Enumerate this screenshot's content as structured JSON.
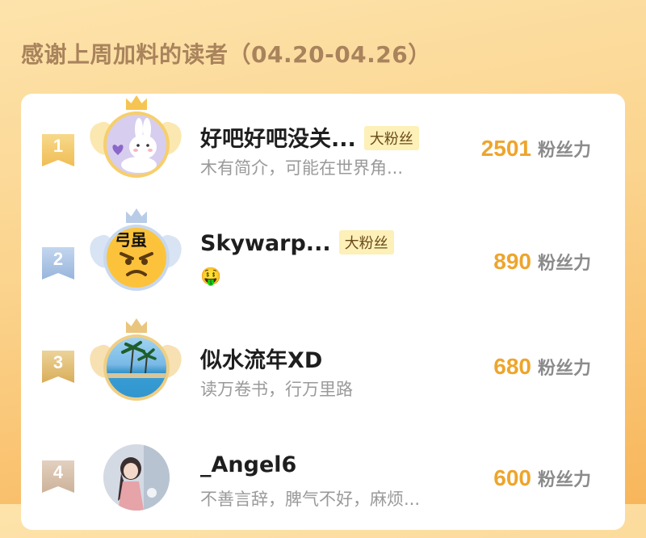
{
  "header": {
    "title": "感谢上周加料的读者（04.20-04.26）"
  },
  "ranking": [
    {
      "rank": "1",
      "name": "好吧好吧没关...",
      "badge": "大粉丝",
      "bio": "木有简介，可能在世界角...",
      "fans": "2501",
      "fans_label": "粉丝力",
      "avatar_icon": "bunny-avatar",
      "rank_color": "#f3c76b"
    },
    {
      "rank": "2",
      "name": "Skywarp...",
      "badge": "大粉丝",
      "bio": "🤑",
      "fans": "890",
      "fans_label": "粉丝力",
      "avatar_icon": "angry-emoji-avatar",
      "rank_color": "#a8c2e2"
    },
    {
      "rank": "3",
      "name": "似水流年XD",
      "badge": "",
      "bio": "读万卷书，行万里路",
      "fans": "680",
      "fans_label": "粉丝力",
      "avatar_icon": "beach-avatar",
      "rank_color": "#e6c37c"
    },
    {
      "rank": "4",
      "name": "_Angel6",
      "badge": "",
      "bio": "不善言辞，脾气不好，麻烦...",
      "fans": "600",
      "fans_label": "粉丝力",
      "avatar_icon": "anime-girl-avatar",
      "rank_color": "#d9c4b0"
    }
  ],
  "colors": {
    "accent": "#eea52c",
    "title": "#a9835c",
    "badge_bg": "#fdf0b8"
  }
}
